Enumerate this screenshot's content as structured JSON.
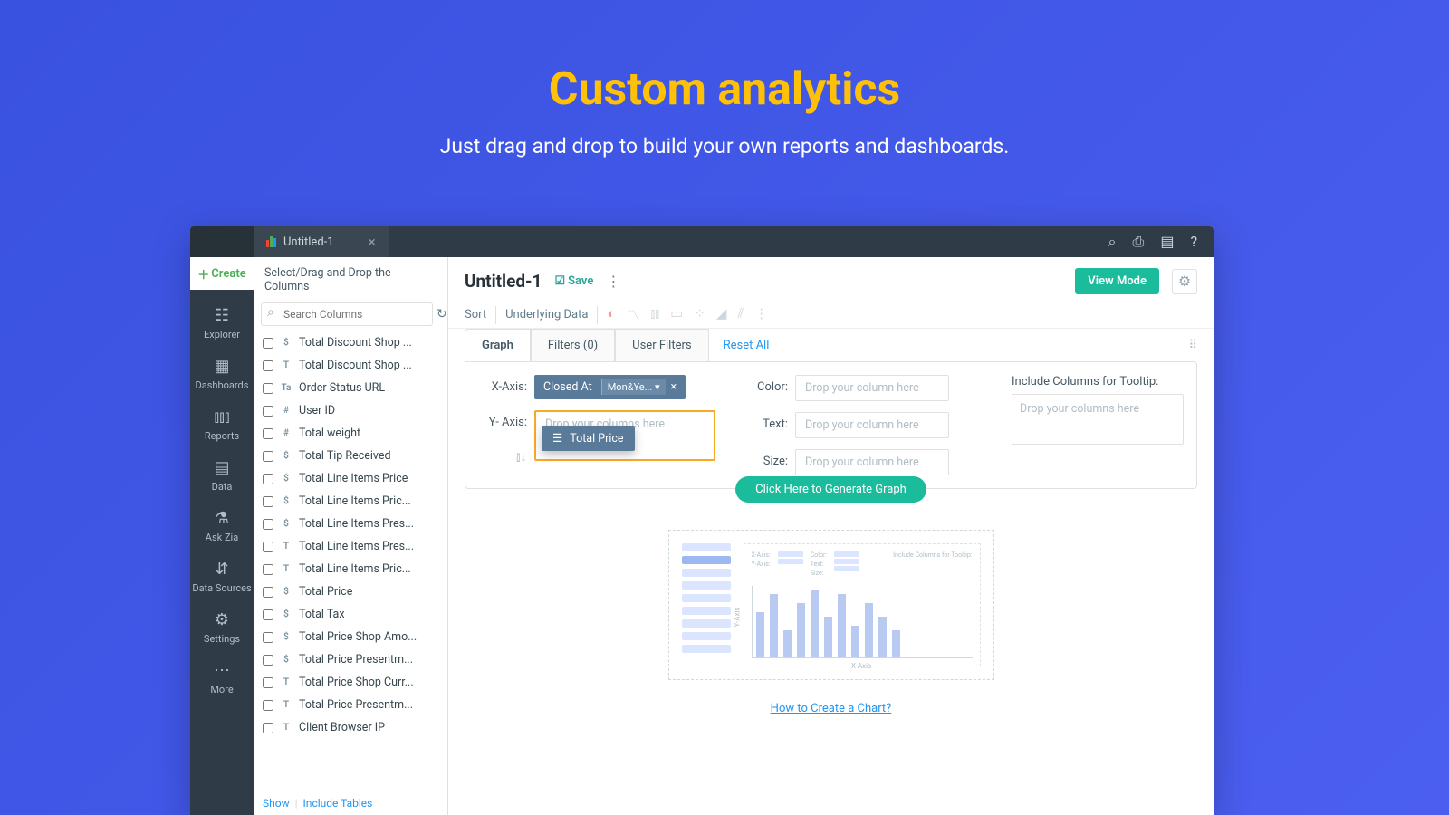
{
  "hero": {
    "title": "Custom analytics",
    "subtitle": "Just drag and drop to build your own reports and dashboards."
  },
  "tab": {
    "title": "Untitled-1"
  },
  "leftnav": {
    "create": "Create",
    "items": [
      {
        "label": "Explorer"
      },
      {
        "label": "Dashboards"
      },
      {
        "label": "Reports"
      },
      {
        "label": "Data"
      },
      {
        "label": "Ask Zia"
      },
      {
        "label": "Data Sources"
      },
      {
        "label": "Settings"
      },
      {
        "label": "More"
      }
    ]
  },
  "colpanel": {
    "header": "Select/Drag and Drop the Columns",
    "search_placeholder": "Search Columns",
    "columns": [
      {
        "type": "$",
        "name": "Total Discount Shop ..."
      },
      {
        "type": "T",
        "name": "Total Discount Shop ..."
      },
      {
        "type": "Ta",
        "name": "Order Status URL"
      },
      {
        "type": "#",
        "name": "User ID"
      },
      {
        "type": "#",
        "name": "Total weight"
      },
      {
        "type": "$",
        "name": "Total Tip Received"
      },
      {
        "type": "$",
        "name": "Total Line Items Price"
      },
      {
        "type": "$",
        "name": "Total Line Items Pric..."
      },
      {
        "type": "$",
        "name": "Total Line Items Pres..."
      },
      {
        "type": "T",
        "name": "Total Line Items Pres..."
      },
      {
        "type": "T",
        "name": "Total Line Items Pric..."
      },
      {
        "type": "$",
        "name": "Total Price"
      },
      {
        "type": "$",
        "name": "Total Tax"
      },
      {
        "type": "$",
        "name": "Total Price Shop Amo..."
      },
      {
        "type": "$",
        "name": "Total Price Presentm..."
      },
      {
        "type": "T",
        "name": "Total Price Shop Curr..."
      },
      {
        "type": "T",
        "name": "Total Price Presentm..."
      },
      {
        "type": "T",
        "name": "Client Browser IP"
      }
    ],
    "show": "Show",
    "include": "Include Tables"
  },
  "main": {
    "title": "Untitled-1",
    "save": "Save",
    "viewmode": "View Mode",
    "toolbar": {
      "sort": "Sort",
      "underlying": "Underlying Data"
    },
    "tabs": {
      "graph": "Graph",
      "filters": "Filters  (0)",
      "userfilters": "User Filters",
      "reset": "Reset All"
    },
    "axes": {
      "x_label": "X-Axis:",
      "x_chip": "Closed At",
      "x_agg": "Mon&Ye...",
      "y_label": "Y- Axis:",
      "y_placeholder": "Drop your columns here",
      "drag_chip": "Total Price",
      "color_label": "Color:",
      "text_label": "Text:",
      "size_label": "Size:",
      "drop_placeholder": "Drop your column here",
      "tooltip_header": "Include Columns for Tooltip:",
      "tooltip_placeholder": "Drop your columns here"
    },
    "generate": "Click Here to Generate Graph",
    "preview": {
      "xaxis": "X-Axis",
      "yaxis": "Y-Axis"
    },
    "howto": "How to Create a Chart?"
  },
  "chart_data": {
    "type": "bar",
    "note": "illustrative placeholder preview only; no real data values shown",
    "bars": [
      50,
      70,
      30,
      60,
      75,
      45,
      70,
      35,
      60,
      45,
      30
    ]
  }
}
